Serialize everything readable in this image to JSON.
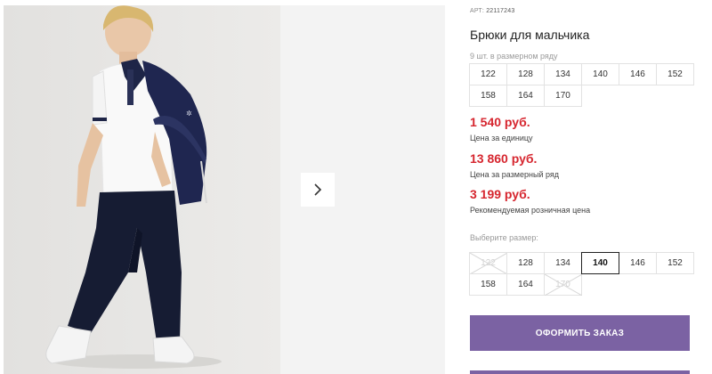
{
  "product": {
    "sku_label": "АРТ:",
    "sku_value": "22117243",
    "title": "Брюки для мальчика",
    "pack_label": "9 шт. в размерном ряду",
    "pack_sizes": [
      "122",
      "128",
      "134",
      "140",
      "146",
      "152",
      "158",
      "164",
      "170"
    ]
  },
  "prices": [
    {
      "value": "1 540 руб.",
      "note": "Цена за единицу"
    },
    {
      "value": "13 860 руб.",
      "note": "Цена за размерный ряд"
    },
    {
      "value": "3 199 руб.",
      "note": "Рекомендуемая розничная цена"
    }
  ],
  "size_select": {
    "label": "Выберите размер:",
    "options": [
      {
        "size": "122",
        "state": "unavailable"
      },
      {
        "size": "128",
        "state": "available"
      },
      {
        "size": "134",
        "state": "available"
      },
      {
        "size": "140",
        "state": "selected"
      },
      {
        "size": "146",
        "state": "available"
      },
      {
        "size": "152",
        "state": "available"
      },
      {
        "size": "158",
        "state": "available"
      },
      {
        "size": "164",
        "state": "available"
      },
      {
        "size": "170",
        "state": "unavailable"
      }
    ]
  },
  "actions": {
    "order_label": "ОФОРМИТЬ ЗАКАЗ"
  },
  "gallery": {
    "next_icon": "chevron-right-icon"
  },
  "colors": {
    "price_red": "#d6262f",
    "button_purple": "#7b62a3"
  }
}
